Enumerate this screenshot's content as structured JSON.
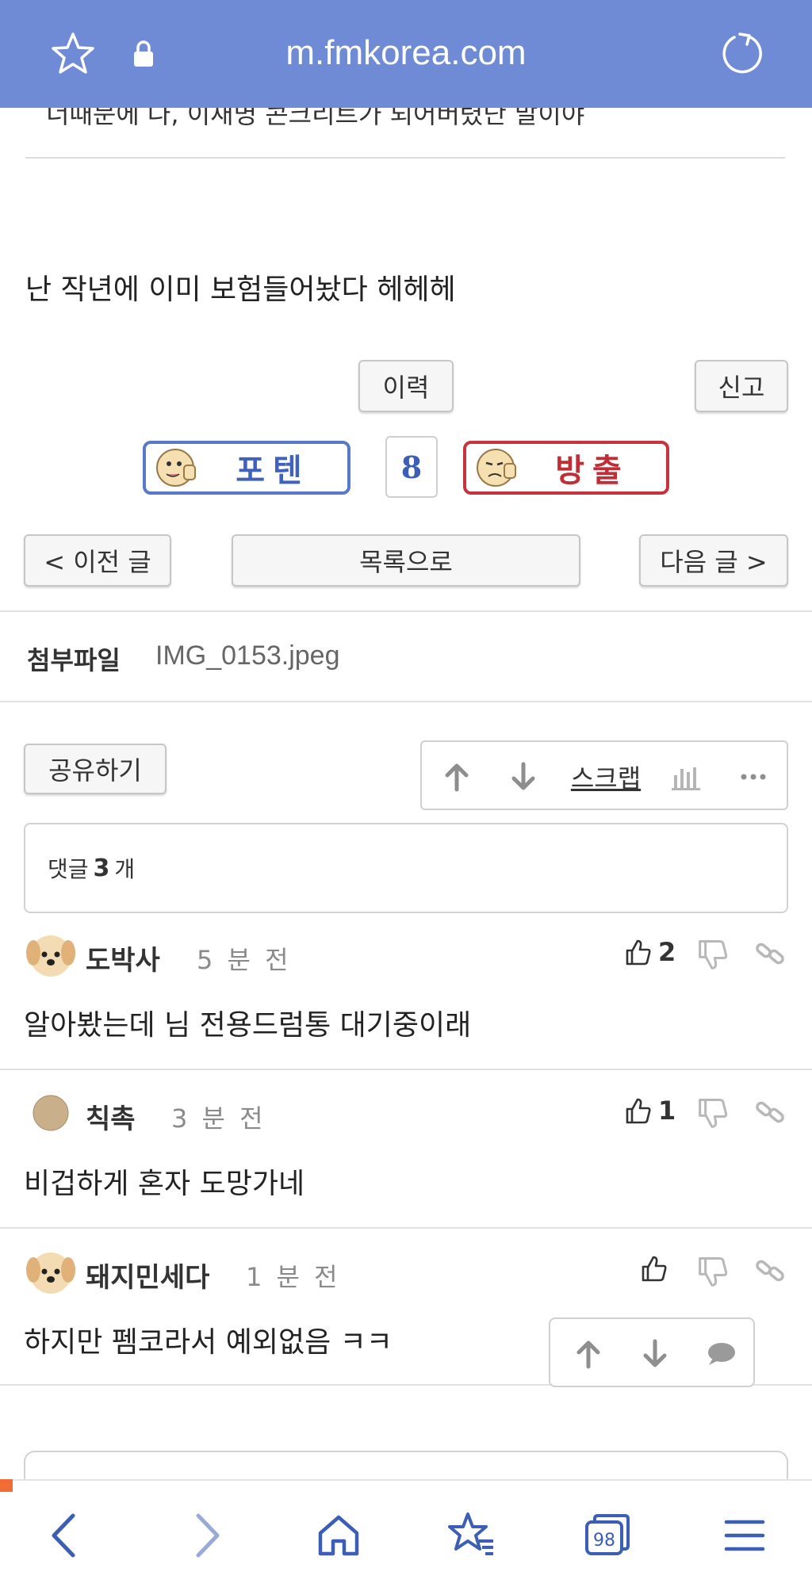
{
  "browser": {
    "url": "m.fmkorea.com"
  },
  "post": {
    "cut_text": "너때문에 나, 이재명 콘크리트가 되어버렸단 말이야",
    "body": "난 작년에 이미 보험들어놨다 헤헤헤",
    "history_label": "이력",
    "report_label": "신고",
    "upvote_label": "포텐",
    "downvote_label": "방출",
    "vote_count": "8",
    "prev_label": "< 이전 글",
    "list_label": "목록으로",
    "next_label": "다음 글 >"
  },
  "attachment": {
    "label": "첨부파일",
    "filename": "IMG_0153.jpeg"
  },
  "actions": {
    "share_label": "공유하기",
    "scrap_label": "스크랩"
  },
  "comment_summary": {
    "prefix": "댓글",
    "count": "3",
    "suffix": "개"
  },
  "comments": [
    {
      "nick": "도박사",
      "time": "5 분 전",
      "likes": "2",
      "body": "알아봤는데 님 전용드럼통 대기중이래"
    },
    {
      "nick": "칙촉",
      "time": "3 분 전",
      "likes": "1",
      "body": "비겁하게 혼자 도망가네"
    },
    {
      "nick": "돼지민세다",
      "time": "1 분 전",
      "likes": "",
      "body": "하지만 펨코라서 예외없음 ㅋㅋ"
    }
  ],
  "tabs_count": "98",
  "colors": {
    "topbar": "#6f8bd6",
    "upvote": "#3e62bd",
    "downvote": "#c22d35",
    "notification": "#f26d36"
  }
}
